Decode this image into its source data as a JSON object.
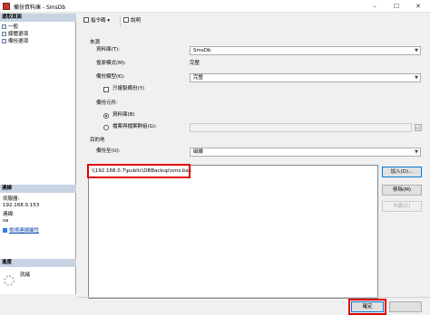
{
  "window": {
    "title": "備份資料庫 - SmsDb"
  },
  "left": {
    "select_page_header": "選取頁面",
    "pages": [
      {
        "label": "一般"
      },
      {
        "label": "媒體選項"
      },
      {
        "label": "備份選項"
      }
    ],
    "connection_header": "連線",
    "server_label": "伺服器:",
    "server_value": "192.168.0.153",
    "connection_label": "連線:",
    "connection_value": "sa",
    "view_connection_link": "檢視連線屬性",
    "progress_header": "進度",
    "progress_status": "就緒"
  },
  "toolbar": {
    "script_label": "指令碼",
    "help_label": "說明"
  },
  "source": {
    "group_label": "來源",
    "database_label": "資料庫(T):",
    "database_value": "SmsDb",
    "recovery_label": "復原模式(M):",
    "recovery_value": "完整",
    "backup_type_label": "備份類型(K):",
    "backup_type_value": "完整",
    "copy_only_label": "只複製備份(Y)",
    "component_label": "備份元件:",
    "opt_database_label": "資料庫(B)",
    "opt_files_label": "檔案與檔案群組(G):"
  },
  "destination": {
    "group_label": "目的地",
    "backup_to_label": "備份至(U):",
    "backup_to_value": "磁碟",
    "paths": [
      "\\\\192.168.0.7\\public\\DBBackup\\sms.bak"
    ],
    "add_label": "加入(D)...",
    "remove_label": "移除(M)",
    "contents_label": "內容(C)"
  },
  "footer": {
    "ok_label": "確定"
  },
  "colors": {
    "highlight": "#e00000",
    "section_header": "#c8d3e3"
  }
}
